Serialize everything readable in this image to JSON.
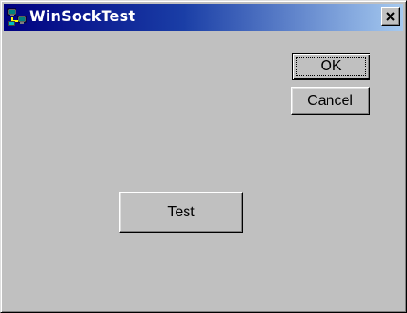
{
  "window": {
    "title": "WinSockTest",
    "icon": "app-network-icon",
    "close_icon": "close-icon"
  },
  "buttons": {
    "ok_label": "OK",
    "cancel_label": "Cancel",
    "test_label": "Test"
  },
  "colors": {
    "titlebar_start": "#000080",
    "titlebar_end": "#a6caf0",
    "face": "#c0c0c0"
  }
}
